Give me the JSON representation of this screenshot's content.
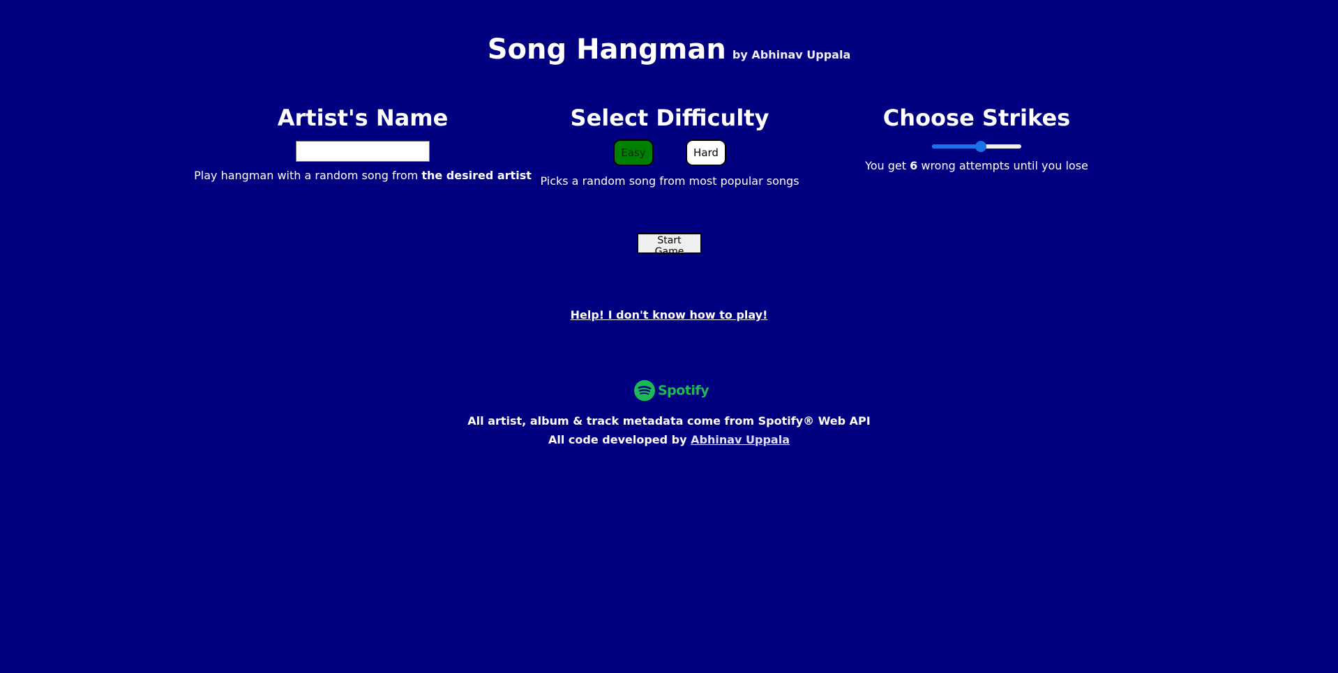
{
  "header": {
    "title": "Song Hangman",
    "byline": "by Abhinav Uppala"
  },
  "artist": {
    "heading": "Artist's Name",
    "input_value": "",
    "desc_prefix": "Play hangman with a random song from ",
    "desc_bold": "the desired artist"
  },
  "difficulty": {
    "heading": "Select Difficulty",
    "easy_label": "Easy",
    "hard_label": "Hard",
    "selected": "Easy",
    "desc": "Picks a random song from most popular songs"
  },
  "strikes": {
    "heading": "Choose Strikes",
    "value": 6,
    "min": 1,
    "max": 10,
    "desc_prefix": "You get ",
    "desc_value": "6",
    "desc_suffix": " wrong attempts until you lose"
  },
  "start_label": "Start Game",
  "help_label": "Help! I don't know how to play!",
  "spotify": {
    "logo_text": "Spotify",
    "brand_color": "#1db954"
  },
  "footer": {
    "line1": "All artist, album & track metadata come from Spotify® Web API",
    "line2_prefix": "All code developed by ",
    "line2_link": "Abhinav Uppala"
  },
  "colors": {
    "background": "#000080",
    "easy_button": "#008000",
    "slider": "#1a73e8"
  }
}
